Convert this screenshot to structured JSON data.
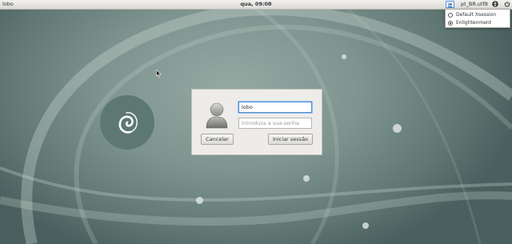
{
  "topbar": {
    "hostname": "lobo",
    "clock": "qua, 09:08",
    "locale": "pt_BR.utf8",
    "session_icon": "session-icon",
    "accessibility_icon": "accessibility-icon",
    "power_icon": "power-icon"
  },
  "session_menu": {
    "items": [
      {
        "label": "Default Xsession",
        "selected": false
      },
      {
        "label": "Enlightenment",
        "selected": true
      }
    ]
  },
  "login": {
    "avatar_icon": "user-avatar-icon",
    "username_value": "lobo",
    "password_placeholder": "Introduza a sua senha",
    "cancel_label": "Cancelar",
    "login_label": "Iniciar sessão"
  },
  "desktop": {
    "logo_icon": "debian-swirl-logo-icon"
  },
  "colors": {
    "background": "#7e948f",
    "focus": "#4a90d9",
    "panel": "#edecea"
  }
}
